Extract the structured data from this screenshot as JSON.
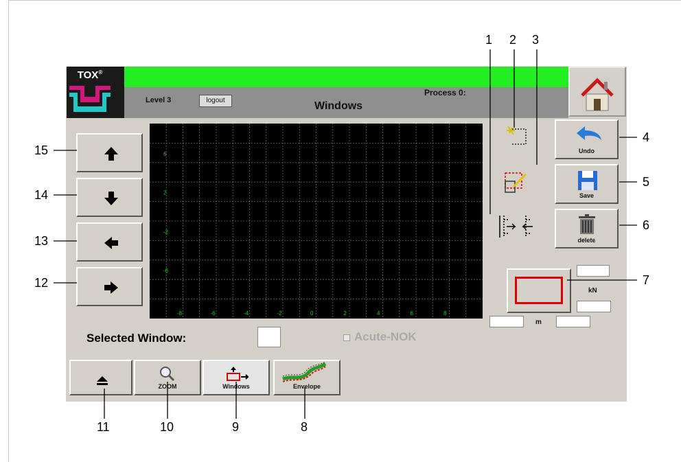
{
  "header": {
    "brand": "TOX",
    "brand_mark": "®",
    "level": "Level 3",
    "logout_label": "logout",
    "process": "Process 0:",
    "title": "Windows",
    "status_color": "#22ee22"
  },
  "graph": {
    "y_ticks": [
      "6",
      "2",
      "-2",
      "-6"
    ],
    "x_ticks": [
      "-8",
      "-6",
      "-4",
      "-2",
      "0",
      "2",
      "4",
      "6",
      "8"
    ]
  },
  "tools": {
    "undo_label": "Undo",
    "save_label": "Save",
    "delete_label": "delete"
  },
  "force": {
    "unit_force": "kN",
    "unit_distance": "m",
    "frame_color": "#e00000"
  },
  "selection": {
    "selected_window_label": "Selected Window:",
    "acute_nok_label": "Acute-NOK"
  },
  "nav": {
    "zoom_label": "ZOOM",
    "windows_label": "Windows",
    "envelope_label": "Envelope"
  },
  "callouts": [
    "1",
    "2",
    "3",
    "4",
    "5",
    "6",
    "7",
    "8",
    "9",
    "10",
    "11",
    "12",
    "13",
    "14",
    "15"
  ],
  "icons": [
    "home-icon",
    "arrow-up-icon",
    "arrow-down-icon",
    "arrow-left-icon",
    "arrow-right-icon",
    "new-window-icon",
    "edit-window-icon",
    "align-windows-icon",
    "undo-icon",
    "save-icon",
    "trash-icon",
    "eject-icon",
    "zoom-icon",
    "windows-icon",
    "envelope-icon"
  ]
}
